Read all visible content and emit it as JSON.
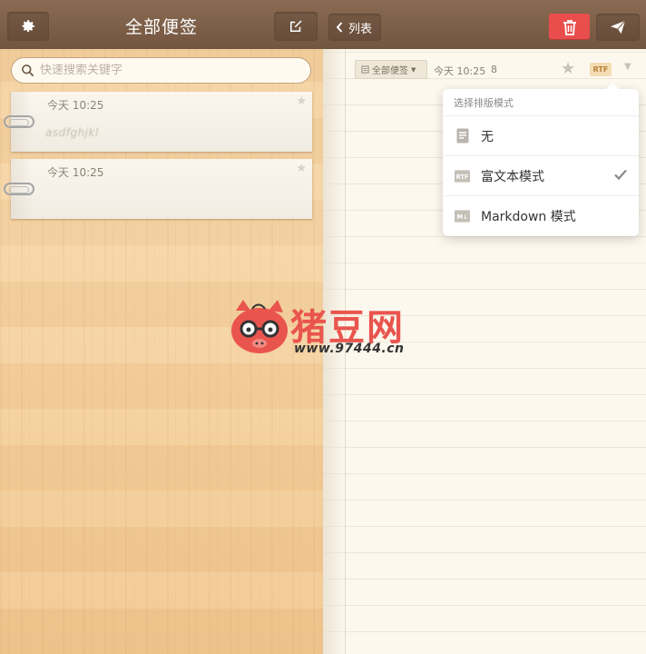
{
  "left_pane": {
    "title": "全部便签",
    "search_placeholder": "快速搜索关键字",
    "notes": [
      {
        "time": "今天 10:25",
        "preview": "asdfghjkl"
      },
      {
        "time": "今天 10:25",
        "preview": ""
      }
    ]
  },
  "right_pane": {
    "back_label": "列表",
    "meta": {
      "folder": "全部便签",
      "time": "今天 10:25",
      "char_count": "8",
      "format_badge": "RTF"
    },
    "dropdown": {
      "title": "选择排版模式",
      "options": [
        {
          "label": "无",
          "icon": "document-icon",
          "selected": false
        },
        {
          "label": "富文本模式",
          "icon": "rtf-icon",
          "icon_text": "RTF",
          "selected": true
        },
        {
          "label": "Markdown 模式",
          "icon": "markdown-icon",
          "icon_text": "M↓",
          "selected": false
        }
      ]
    }
  },
  "watermark": {
    "brand": "猪豆网",
    "url": "www.97444.cn"
  },
  "colors": {
    "header": "#7d5f48",
    "delete": "#e94e4c",
    "brand_red": "#e9554e",
    "rtf_badge": "#f4dcb4"
  }
}
